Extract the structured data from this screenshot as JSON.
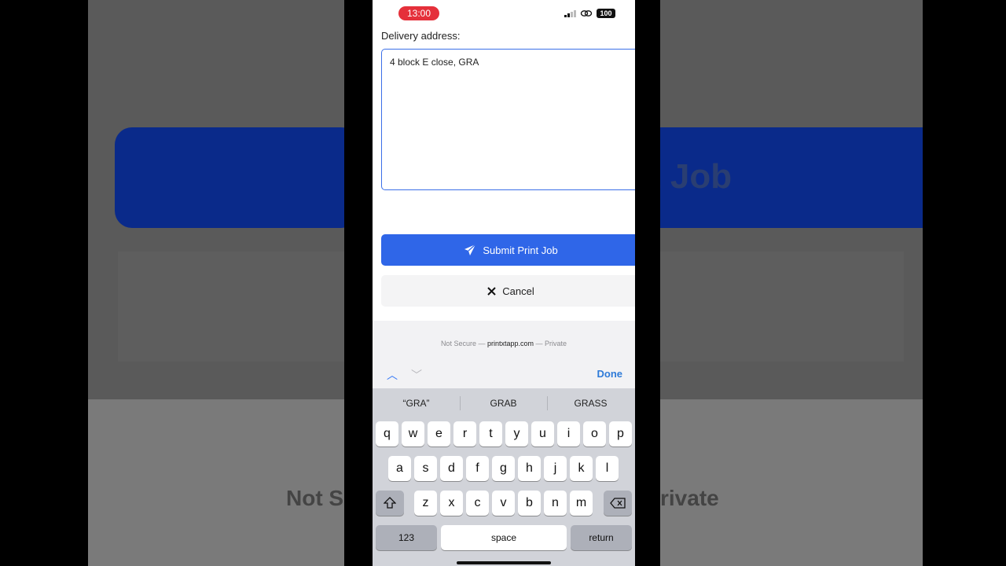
{
  "status": {
    "time": "13:00",
    "battery": "100"
  },
  "form": {
    "delivery_label": "Delivery address:",
    "delivery_value": "4 block E close, GRA",
    "submit_label": "Submit Print Job",
    "cancel_label": "Cancel"
  },
  "browser": {
    "security": "Not Secure —",
    "host": "printxtapp.com",
    "mode": "— Private"
  },
  "toolbar": {
    "up_arrow": "︿",
    "down_arrow": "﹀",
    "done_label": "Done"
  },
  "keyboard": {
    "suggestions": [
      "“GRA”",
      "GRAB",
      "GRASS"
    ],
    "row1": [
      "q",
      "w",
      "e",
      "r",
      "t",
      "y",
      "u",
      "i",
      "o",
      "p"
    ],
    "row2": [
      "a",
      "s",
      "d",
      "f",
      "g",
      "h",
      "j",
      "k",
      "l"
    ],
    "row3": [
      "z",
      "x",
      "c",
      "v",
      "b",
      "n",
      "m"
    ],
    "numbers_label": "123",
    "space_label": "space",
    "return_label": "return"
  },
  "background": {
    "button_text": "t Job",
    "text_left": "Not S",
    "text_right": "rivate"
  },
  "colors": {
    "accent": "#2f66e8",
    "time_pill": "#e5303a",
    "keyboard_bg": "#d1d3d9"
  },
  "icons": {
    "submit": "paper-plane-icon",
    "cancel": "close-icon",
    "shift": "shift-icon",
    "delete": "backspace-icon"
  }
}
